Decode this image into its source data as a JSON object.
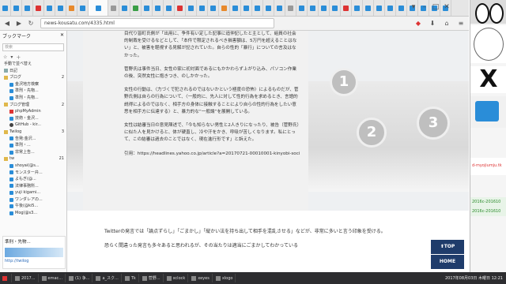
{
  "browser": {
    "url": "news-kousatu.com/4335.html",
    "tab_count": 40
  },
  "sidebar": {
    "title": "ブックマーク",
    "search_placeholder": "検索",
    "bookmarks": [
      {
        "label": "手動で並べ替え",
        "icon": "text",
        "count": ""
      },
      {
        "label": "日記",
        "icon": "page",
        "count": ""
      },
      {
        "label": "ブログ",
        "icon": "folder",
        "count": "2"
      },
      {
        "label": "金沢地方検察",
        "icon": "tw",
        "count": ""
      },
      {
        "label": "準刑・先物...",
        "icon": "tw",
        "count": ""
      },
      {
        "label": "準刑・先物...",
        "icon": "tw",
        "count": ""
      },
      {
        "label": "ブログ管理",
        "icon": "folder",
        "count": "2"
      },
      {
        "label": "phpMyAdmin",
        "icon": "red",
        "count": ""
      },
      {
        "label": "技術・金沢...",
        "icon": "tw",
        "count": ""
      },
      {
        "label": "GitHub - kir...",
        "icon": "dk",
        "count": ""
      },
      {
        "label": "Twilog",
        "icon": "folder",
        "count": "3"
      },
      {
        "label": "告発:金沢...",
        "icon": "tw",
        "count": ""
      },
      {
        "label": "準刑・...",
        "icon": "tw",
        "count": ""
      },
      {
        "label": "非常上告...",
        "icon": "tw",
        "count": ""
      },
      {
        "label": "tw",
        "icon": "folder",
        "count": "21"
      },
      {
        "label": "shoyai(@s...",
        "icon": "tw",
        "count": ""
      },
      {
        "label": "モンスター弁...",
        "icon": "tw",
        "count": ""
      },
      {
        "label": "よもぎ(@...",
        "icon": "tw",
        "count": ""
      },
      {
        "label": "法律事務所...",
        "icon": "tw",
        "count": ""
      },
      {
        "label": "yuji kigami...",
        "icon": "tw",
        "count": ""
      },
      {
        "label": "ワンダレアの...",
        "icon": "tw",
        "count": ""
      },
      {
        "label": "午後(@ki5...",
        "icon": "tw",
        "count": ""
      },
      {
        "label": "Mog(@s3...",
        "icon": "tw",
        "count": ""
      }
    ],
    "status_title": "準刑・先物...",
    "status_url": "http://twilog"
  },
  "article": {
    "paragraphs": [
      "目代り皆町氏側が「出用に、争件有い定した記事に追仲記したと主として、組員の社会的制裁を受けるなどとして、「本件で限定されるべき損害額は、5万円を超えることはない」と、被害を軽視する見解が記されていた。自らの性的「暴行」についての言及はなかった。",
      "菅野氏は事件当日、女性の家に初対面であるにもかかわらず上がり込み、パソコン作業の後、突然女性に抱きつき、のしかかった。",
      "女性の行動は、〈力づくで犯されるのではないかという極度の恐怖〉によるものだが、菅野氏側は自らの行為について、〈一般的に、先人に対して性的行為を求めるとき、言語的説得によるのではなく、相手方の身体に接触することにより自らの性的行為をしたい意思を相手方に伝達する〉と、暴力的な“一般論”を展開している。",
      "女性は結審当日の意見陳述で、「今も知らない男性と2人きりになったり、被告（菅野氏）に似た人を見かけると、体が硬直し、冷や汗をかき、呼吸が苦しくなります。私にとって、この結審は過去のことではなく、現在進行形です」と訴えた。",
      "引用：https://headlines.yahoo.co.jp/article?a=20170721-00010001-kinyobi-soci"
    ],
    "after_paragraphs": [
      "Twitterの発言では「論点ずらし」「ごまかし」「縦かい法を持ち出して相手を混乱させる」などが、非常に多いと言う印象を受ける。",
      "恐らく間違った発言も多々あると思われるが、その当たりは適当にごまかしてわかっている"
    ],
    "circles": [
      "1",
      "2",
      "3"
    ]
  },
  "buttons": {
    "top": "⬆TOP",
    "home": "HOME"
  },
  "right_pane": {
    "red_label": "d-myojiumju.tk",
    "date1": "2016c-201610",
    "date2": "2016c-201610"
  },
  "taskbar": {
    "items": [
      "2017...",
      "emac...",
      "(1) 争...",
      "a_スク...",
      "Tk",
      "菅野...",
      "xclock",
      "xeyes",
      "xlogo"
    ],
    "clock": "2017年08月03日 木曜日 12:21"
  }
}
